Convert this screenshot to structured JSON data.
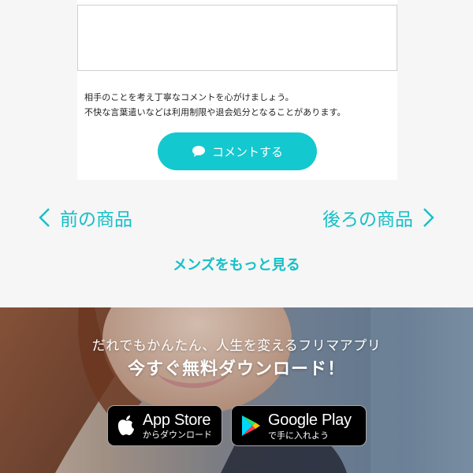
{
  "comment": {
    "textarea_value": "",
    "notice_lines": [
      "相手のことを考え丁寧なコメントを心がけましょう。",
      "不快な言葉遣いなどは利用制限や退会処分となることがあります。"
    ],
    "button_label": "コメントする",
    "button_icon": "speech-bubble-icon"
  },
  "nav": {
    "prev_label": "前の商品",
    "next_label": "後ろの商品",
    "more_label": "メンズをもっと見る"
  },
  "banner": {
    "subtitle": "だれでもかんたん、人生を変えるフリマアプリ",
    "title": "今すぐ無料ダウンロード！",
    "appstore": {
      "main": "App Store",
      "sub": "からダウンロード"
    },
    "googleplay": {
      "main": "Google Play",
      "sub": "で手に入れよう"
    }
  },
  "colors": {
    "accent": "#14c8cf",
    "link": "#14c0c8",
    "panel": "#ffffff",
    "page_bg": "#f6f6f6"
  }
}
